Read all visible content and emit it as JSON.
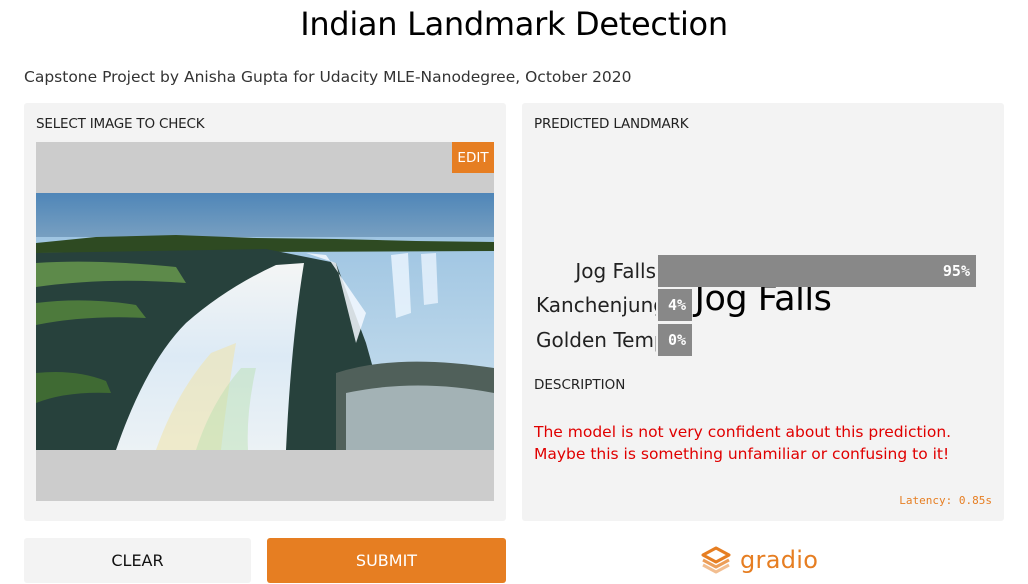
{
  "header": {
    "title": "Indian Landmark Detection",
    "subtitle": "Capstone Project by Anisha Gupta for Udacity MLE-Nanodegree, October 2020"
  },
  "input_panel": {
    "label": "SELECT IMAGE TO CHECK",
    "edit_label": "EDIT"
  },
  "output_panel": {
    "label": "PREDICTED LANDMARK",
    "prediction": "Jog Falls",
    "confidences": [
      {
        "label": "Jog Falls",
        "value": 0.95,
        "display": "95%"
      },
      {
        "label": "Kanchenjunga",
        "value": 0.04,
        "display": "4%"
      },
      {
        "label": "Golden Temple",
        "value": 0.0,
        "display": "0%"
      }
    ],
    "description_label": "DESCRIPTION",
    "description": "The model is not very confident about this prediction. Maybe this is something unfamiliar or confusing to it!",
    "latency": "Latency: 0.85s"
  },
  "actions": {
    "clear_label": "CLEAR",
    "submit_label": "SUBMIT"
  },
  "brand": {
    "name": "gradio",
    "icon": "gradio-logo-icon"
  },
  "colors": {
    "accent": "#e67e22",
    "panel_bg": "#f3f3f3",
    "bar": "#888888",
    "warning_text": "#e00000"
  }
}
